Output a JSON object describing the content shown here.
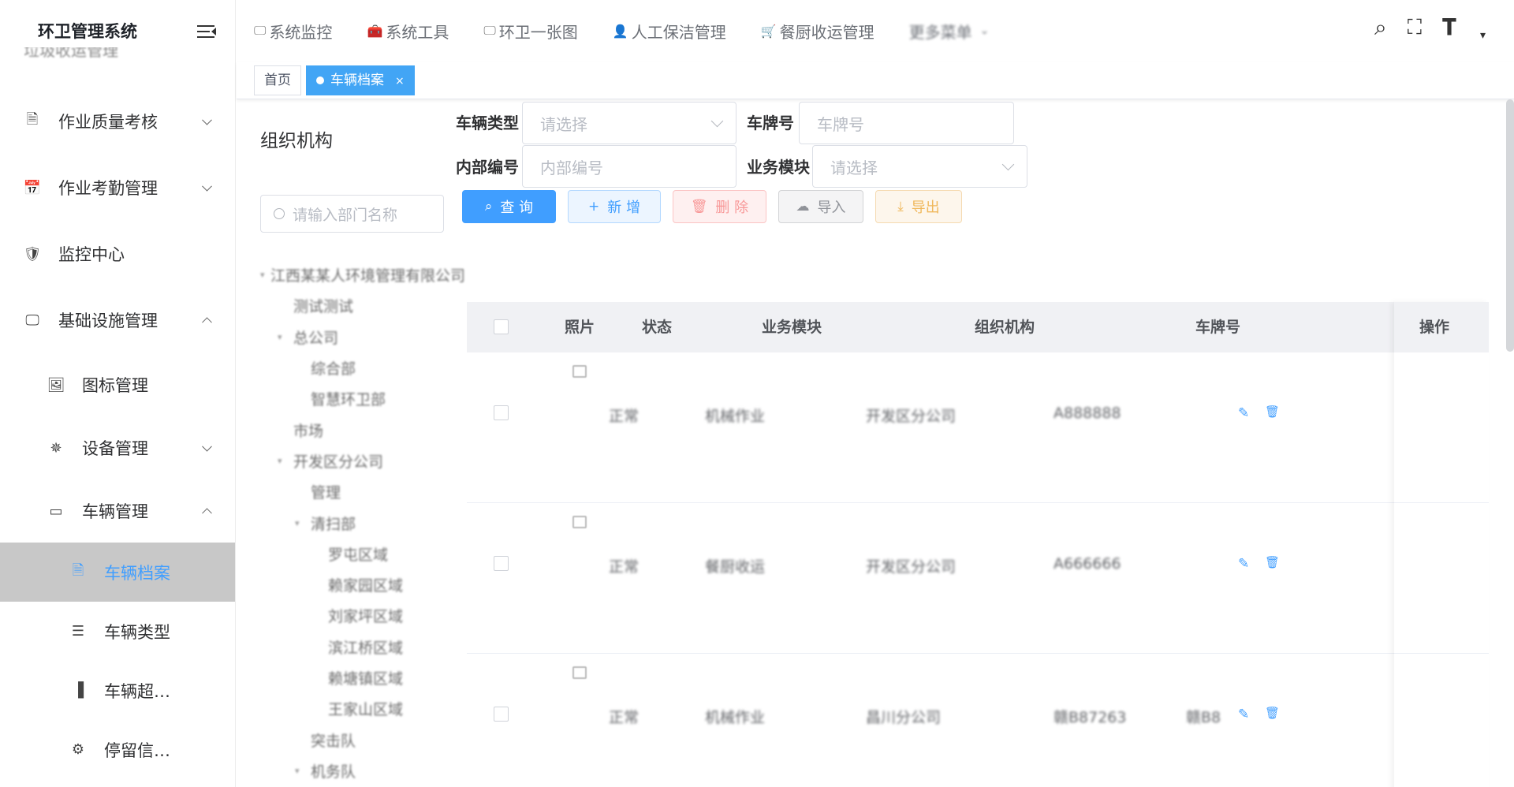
{
  "app": {
    "title": "环卫管理系统"
  },
  "sidebar": {
    "cut_item": "垃圾收运管理",
    "items": [
      {
        "label": "作业质量考核",
        "icon": "document-icon",
        "level": 0,
        "arrow": "down"
      },
      {
        "label": "作业考勤管理",
        "icon": "calendar-icon",
        "level": 0,
        "arrow": "down"
      },
      {
        "label": "监控中心",
        "icon": "shield-icon",
        "level": 0,
        "arrow": ""
      },
      {
        "label": "基础设施管理",
        "icon": "monitor-icon",
        "level": 0,
        "arrow": "up"
      },
      {
        "label": "图标管理",
        "icon": "image-icon",
        "level": 1,
        "arrow": ""
      },
      {
        "label": "设备管理",
        "icon": "device-icon",
        "level": 1,
        "arrow": "down"
      },
      {
        "label": "车辆管理",
        "icon": "card-icon",
        "level": 1,
        "arrow": "up"
      },
      {
        "label": "车辆档案",
        "icon": "file-icon",
        "level": 2,
        "arrow": "",
        "active": true
      },
      {
        "label": "车辆类型",
        "icon": "list-icon",
        "level": 2,
        "arrow": ""
      },
      {
        "label": "车辆超…",
        "icon": "bar-chart-icon",
        "level": 2,
        "arrow": ""
      },
      {
        "label": "停留信…",
        "icon": "gear-icon",
        "level": 2,
        "arrow": ""
      }
    ]
  },
  "topnav": {
    "items": [
      {
        "label": "系统监控",
        "icon": "monitor-icon"
      },
      {
        "label": "系统工具",
        "icon": "toolbox-icon"
      },
      {
        "label": "环卫一张图",
        "icon": "monitor-icon"
      },
      {
        "label": "人工保洁管理",
        "icon": "user-icon"
      },
      {
        "label": "餐厨收运管理",
        "icon": "cart-icon"
      },
      {
        "label": "更多菜单",
        "icon": "",
        "blur": true,
        "chevron": true
      }
    ]
  },
  "tabs": [
    {
      "label": "首页",
      "active": false
    },
    {
      "label": "车辆档案",
      "active": true,
      "close": "×"
    }
  ],
  "org": {
    "title": "组织机构",
    "search_placeholder": "请输入部门名称",
    "tree": [
      {
        "label": "江西某某人环境管理有限公司",
        "depth": 0,
        "caret": "▾"
      },
      {
        "label": "测试测试",
        "depth": 1,
        "caret": ""
      },
      {
        "label": "总公司",
        "depth": 1,
        "caret": "▾"
      },
      {
        "label": "综合部",
        "depth": 2,
        "caret": ""
      },
      {
        "label": "智慧环卫部",
        "depth": 2,
        "caret": ""
      },
      {
        "label": "市场",
        "depth": 1,
        "caret": ""
      },
      {
        "label": "开发区分公司",
        "depth": 1,
        "caret": "▾"
      },
      {
        "label": "管理",
        "depth": 2,
        "caret": ""
      },
      {
        "label": "清扫部",
        "depth": 2,
        "caret": "▾"
      },
      {
        "label": "罗屯区域",
        "depth": 3,
        "caret": ""
      },
      {
        "label": "赖家园区域",
        "depth": 3,
        "caret": ""
      },
      {
        "label": "刘家坪区域",
        "depth": 3,
        "caret": ""
      },
      {
        "label": "滨江桥区域",
        "depth": 3,
        "caret": ""
      },
      {
        "label": "赖塘镇区域",
        "depth": 3,
        "caret": ""
      },
      {
        "label": "王家山区域",
        "depth": 3,
        "caret": ""
      },
      {
        "label": "突击队",
        "depth": 2,
        "caret": ""
      },
      {
        "label": "机务队",
        "depth": 2,
        "caret": "▾"
      }
    ]
  },
  "filters": {
    "vehicle_type_label": "车辆类型",
    "vehicle_type_placeholder": "请选择",
    "plate_label": "车牌号",
    "plate_placeholder": "车牌号",
    "internal_no_label": "内部编号",
    "internal_no_placeholder": "内部编号",
    "module_label": "业务模块",
    "module_placeholder": "请选择"
  },
  "buttons": {
    "query": "查 询",
    "add": "新 增",
    "delete": "删 除",
    "import": "导入",
    "export": "导出"
  },
  "table": {
    "headers": {
      "photo": "照片",
      "status": "状态",
      "module": "业务模块",
      "org": "组织机构",
      "plate": "车牌号",
      "action": "操作"
    },
    "rows": [
      {
        "status": "正常",
        "module": "机械作业",
        "org": "开发区分公司",
        "plate": "A888888",
        "extra": ""
      },
      {
        "status": "正常",
        "module": "餐厨收运",
        "org": "开发区分公司",
        "plate": "A666666",
        "extra": ""
      },
      {
        "status": "正常",
        "module": "机械作业",
        "org": "昌川分公司",
        "plate": "赣B87263",
        "extra": "赣B8"
      }
    ]
  }
}
